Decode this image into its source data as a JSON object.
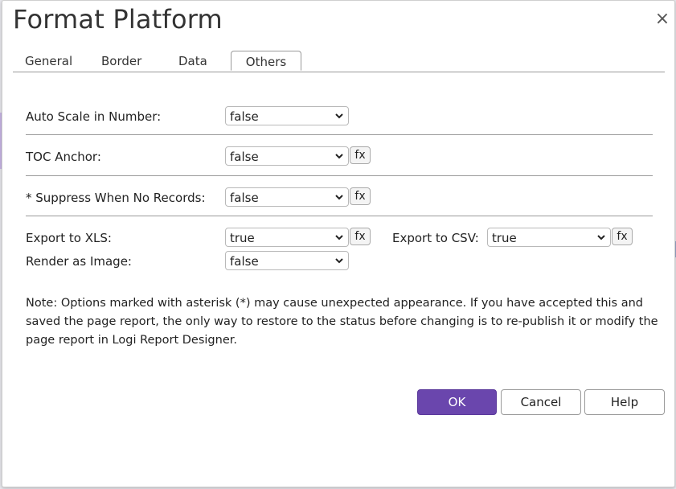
{
  "dialog": {
    "title": "Format Platform",
    "close_symbol": "×"
  },
  "tabs": [
    {
      "label": "General"
    },
    {
      "label": "Border"
    },
    {
      "label": "Data"
    },
    {
      "label": "Others",
      "active": true
    }
  ],
  "fields": {
    "auto_scale": {
      "label": "Auto Scale in Number:",
      "value": "false"
    },
    "toc_anchor": {
      "label": "TOC Anchor:",
      "value": "false",
      "fx": "fx"
    },
    "suppress": {
      "label": "* Suppress When No Records:",
      "value": "false",
      "fx": "fx"
    },
    "export_xls": {
      "label": "Export to XLS:",
      "value": "true",
      "fx": "fx"
    },
    "export_csv": {
      "label": "Export to CSV:",
      "value": "true",
      "fx": "fx"
    },
    "render_image": {
      "label": "Render as Image:",
      "value": "false"
    }
  },
  "note": "Note: Options marked with asterisk (*) may cause unexpected appearance. If you have accepted this and saved the page report, the only way to restore to the status before changing is to re-publish it or modify the page report in Logi Report Designer.",
  "buttons": {
    "ok": "OK",
    "cancel": "Cancel",
    "help": "Help"
  },
  "colors": {
    "accent": "#6a46ad"
  },
  "icons": {
    "close": "close-icon",
    "dropdown": "chevron-down-icon"
  }
}
